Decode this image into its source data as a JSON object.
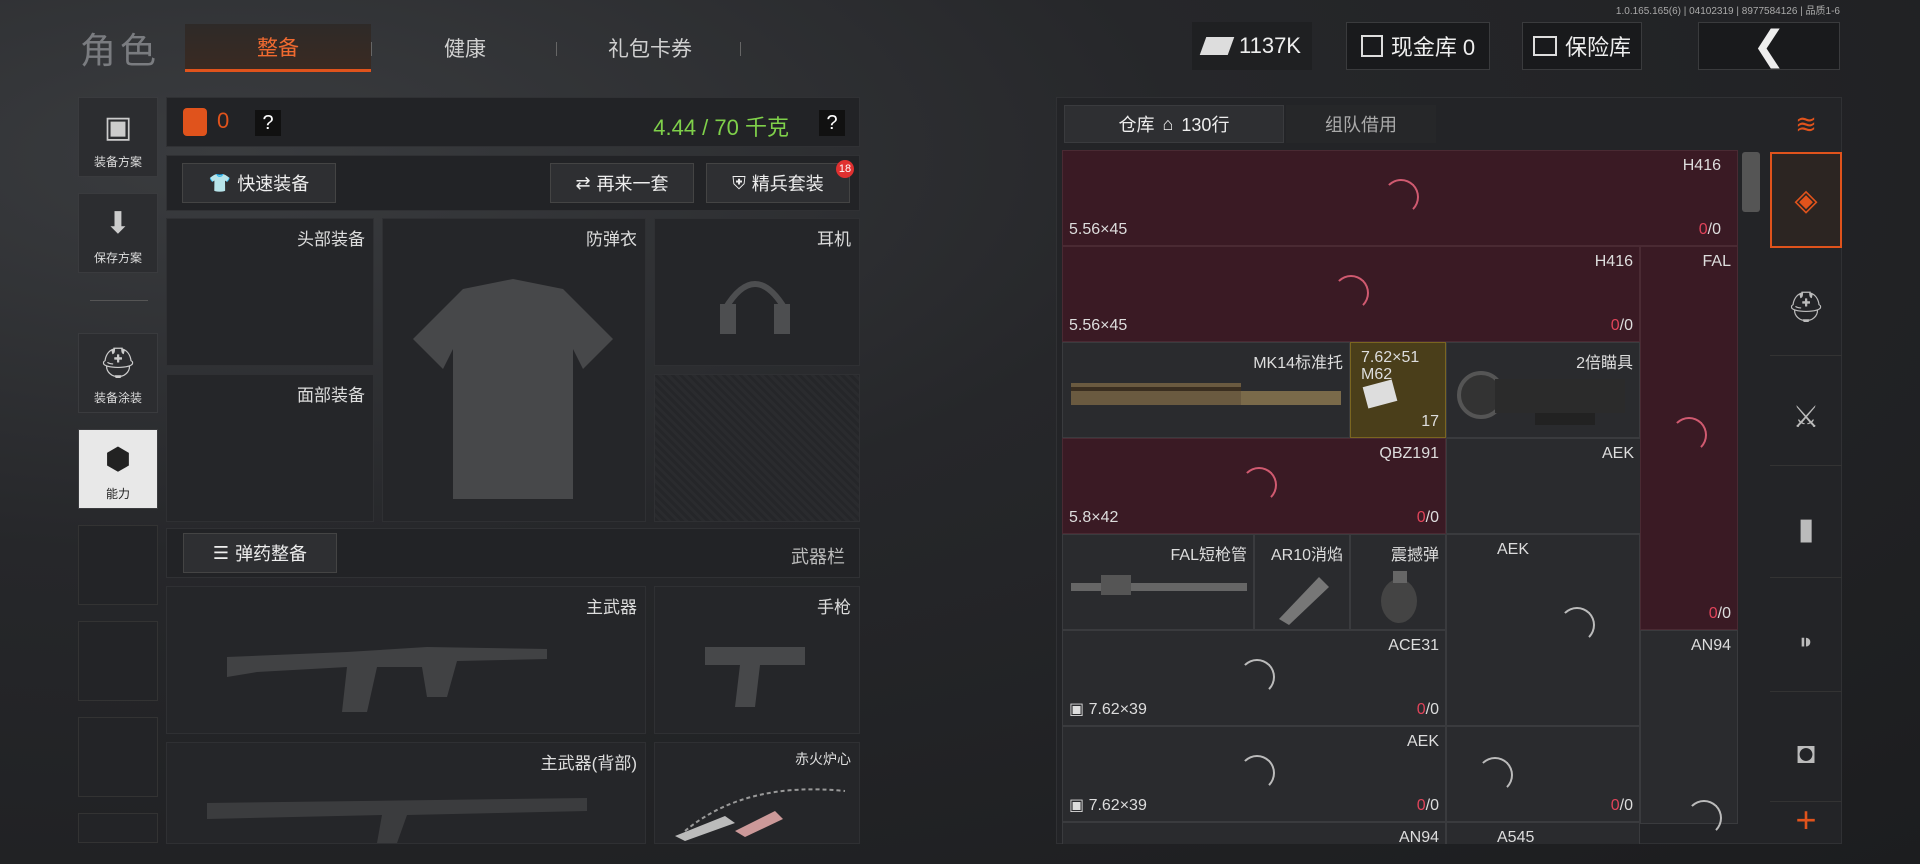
{
  "version": "1.0.165.165(6) | 04102319 | 8977584126 | 品质1-6",
  "header": {
    "title": "角色",
    "tabs": [
      "整备",
      "健康",
      "礼包卡券"
    ],
    "currency": "1137K",
    "cash_vault": "现金库 0",
    "safe": "保险库"
  },
  "left_nav": [
    "装备方案",
    "保存方案",
    "装备涂装",
    "能力"
  ],
  "equipment": {
    "armor_count": "0",
    "weight": "4.44 / 70 千克",
    "help": "?",
    "quick_equip": "快速装备",
    "again_set": "再来一套",
    "elite_set": "精兵套装",
    "elite_badge": "18",
    "slots": {
      "head": "头部装备",
      "vest": "防弹衣",
      "ear": "耳机",
      "face": "面部装备",
      "ammo_equip": "弹药整备",
      "weapon_bar": "武器栏",
      "main_weapon": "主武器",
      "pistol": "手枪",
      "main_back": "主武器(背部)",
      "melee": "赤火炉心"
    }
  },
  "storage": {
    "tab_warehouse": "仓库",
    "rows": "130行",
    "tab_team": "组队借用",
    "cells": [
      {
        "name": "H416",
        "cal": "5.56×45",
        "cnt0": "0",
        "cnt1": "/0"
      },
      {
        "name": "H416",
        "cal": "5.56×45",
        "cnt0": "0",
        "cnt1": "/0"
      },
      {
        "name": "FAL",
        "cal": "",
        "cnt0": "0",
        "cnt1": "/0"
      },
      {
        "name": "MK14标准托"
      },
      {
        "name": "7.62×51 M62",
        "qty": "17"
      },
      {
        "name": "2倍瞄具"
      },
      {
        "name": "QBZ191",
        "cal": "5.8×42",
        "cnt0": "0",
        "cnt1": "/0"
      },
      {
        "name": "AEK"
      },
      {
        "name": "FAL短枪管"
      },
      {
        "name": "AR10消焰"
      },
      {
        "name": "震撼弹"
      },
      {
        "name": "AEK"
      },
      {
        "name": "ACE31",
        "cal": "7.62×39",
        "cnt0": "0",
        "cnt1": "/0"
      },
      {
        "name": "AN94"
      },
      {
        "name": "AEK",
        "cal": "7.62×39",
        "cnt0": "0",
        "cnt1": "/0"
      },
      {
        "name": "AN94"
      },
      {
        "name": "A545"
      }
    ]
  }
}
